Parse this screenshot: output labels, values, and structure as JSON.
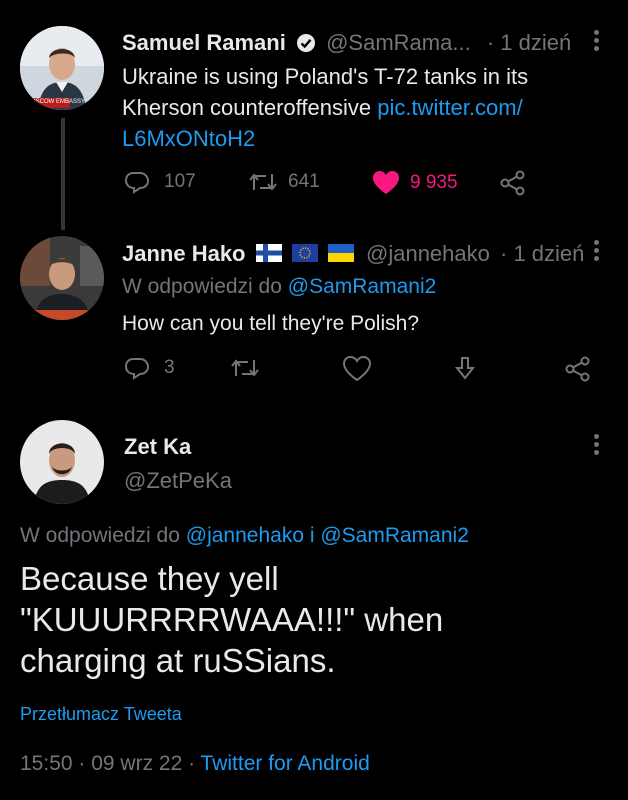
{
  "tweet1": {
    "name": "Samuel Ramani",
    "handle": "@SamRama...",
    "time": "· 1 dzień",
    "text": "Ukraine is using Poland's T-72 tanks in its Kherson counteroffensive ",
    "link_line1": "pic.twitter.com/",
    "link_line2": "L6MxONtoH2",
    "replies": "107",
    "retweets": "641",
    "likes": "9 935",
    "avatar_caption": "MOSCOW EMBASSY"
  },
  "tweet2": {
    "name": "Janne Hako",
    "handle": "@jannehako",
    "time": "· 1 dzień",
    "reply_prefix": "W odpowiedzi do ",
    "reply_to": "@SamRamani2",
    "text": "How can you tell they're Polish?",
    "replies": "3"
  },
  "tweet3": {
    "name": "Zet Ka",
    "handle": "@ZetPeKa",
    "reply_prefix": "W odpowiedzi do ",
    "reply_to": "@jannehako i @SamRamani2",
    "text_line1": "Because they yell",
    "text_line2": "\"KUUURRRRWAAA!!!\" when",
    "text_line3": "charging at ruSSians.",
    "translate": "Przetłumacz Tweeta",
    "timestamp": "15:50 · 09 wrz 22 · ",
    "client": "Twitter for Android"
  },
  "colors": {
    "background": "#000000",
    "link": "#1d9bf0",
    "muted": "#71767b",
    "like": "#f91880"
  }
}
